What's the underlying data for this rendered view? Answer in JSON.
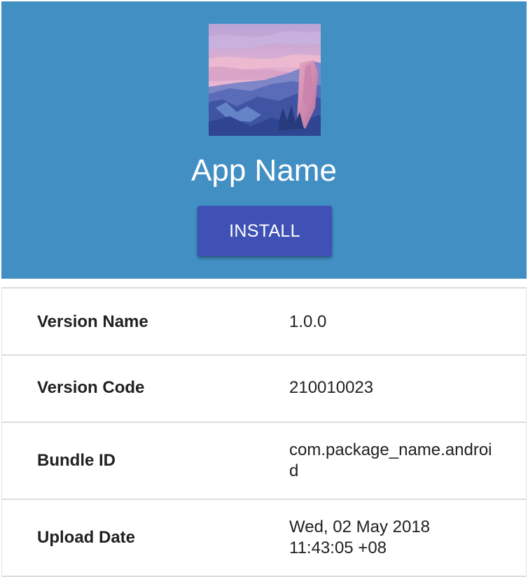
{
  "header": {
    "background_color": "#428fc4",
    "icon": "app-icon-landscape",
    "app_name": "App Name",
    "install_label": "INSTALL",
    "install_color": "#3f51b5"
  },
  "details": [
    {
      "label": "Version Name",
      "value": "1.0.0"
    },
    {
      "label": "Version Code",
      "value": "210010023"
    },
    {
      "label": "Bundle ID",
      "value": "com.package_name.android"
    },
    {
      "label": "Upload Date",
      "value": "Wed, 02 May 2018 11:43:05 +08"
    }
  ]
}
